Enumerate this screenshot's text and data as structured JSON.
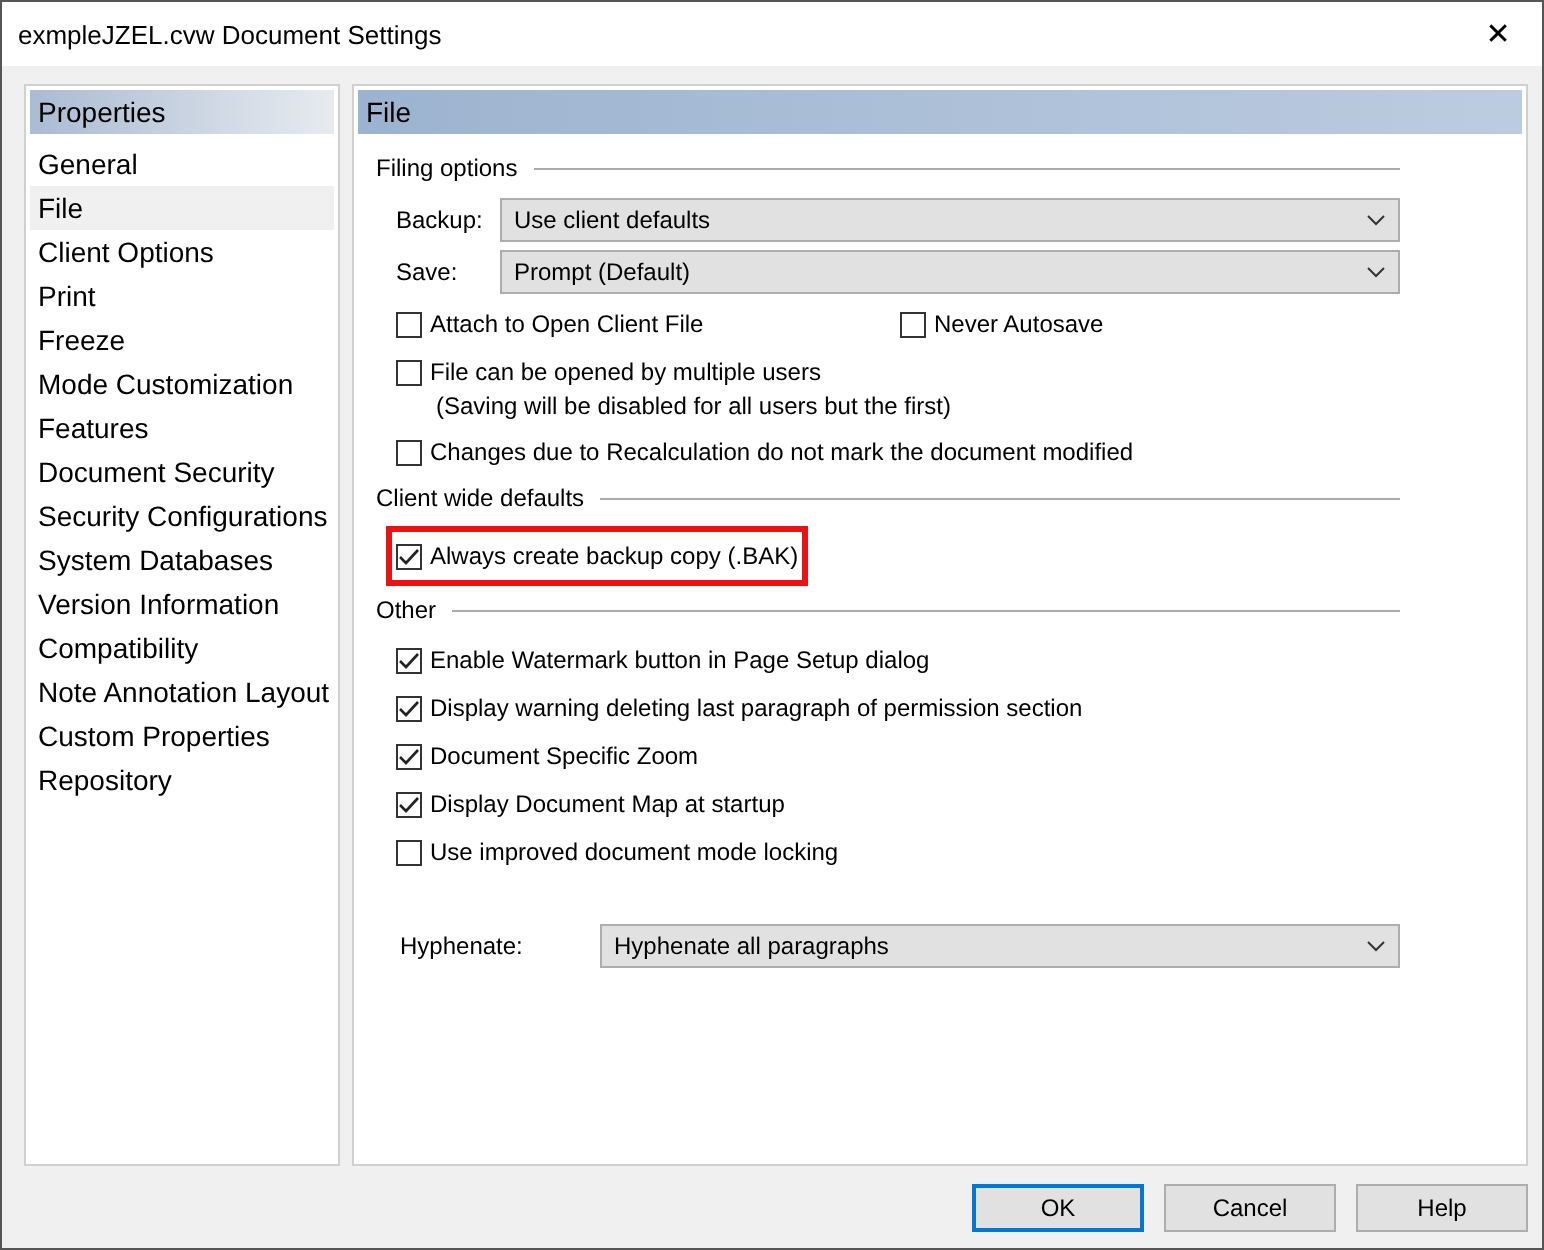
{
  "window": {
    "title": "exmpleJZEL.cvw Document Settings",
    "close": "✕"
  },
  "sidebar": {
    "title": "Properties",
    "items": [
      {
        "label": "General",
        "selected": false
      },
      {
        "label": "File",
        "selected": true
      },
      {
        "label": "Client Options",
        "selected": false
      },
      {
        "label": "Print",
        "selected": false
      },
      {
        "label": "Freeze",
        "selected": false
      },
      {
        "label": "Mode Customization",
        "selected": false
      },
      {
        "label": "Features",
        "selected": false
      },
      {
        "label": "Document Security",
        "selected": false
      },
      {
        "label": "Security Configurations",
        "selected": false
      },
      {
        "label": "System Databases",
        "selected": false
      },
      {
        "label": "Version Information",
        "selected": false
      },
      {
        "label": "Compatibility",
        "selected": false
      },
      {
        "label": "Note Annotation Layout",
        "selected": false
      },
      {
        "label": "Custom Properties",
        "selected": false
      },
      {
        "label": "Repository",
        "selected": false
      }
    ]
  },
  "panel": {
    "title": "File",
    "sections": [
      {
        "title": "Filing options",
        "items": [
          {
            "kind": "dropdown",
            "label": "Backup:",
            "value": "Use client defaults"
          },
          {
            "kind": "dropdown",
            "label": "Save:",
            "value": "Prompt (Default)"
          },
          {
            "kind": "pair",
            "options": [
              {
                "label": "Attach to Open Client File",
                "checked": false
              },
              {
                "label": "Never Autosave",
                "checked": false
              }
            ]
          },
          {
            "kind": "checkbox",
            "label": "File can be opened by multiple users",
            "note": "(Saving will be disabled for all users but the first)",
            "checked": false
          },
          {
            "kind": "checkbox",
            "label": "Changes due to Recalculation do not mark the document modified",
            "checked": false
          }
        ]
      },
      {
        "title": "Client wide defaults",
        "items": [
          {
            "kind": "checkbox",
            "label": "Always create backup copy (.BAK)",
            "checked": true,
            "highlighted": true
          }
        ]
      },
      {
        "title": "Other",
        "items": [
          {
            "kind": "checkbox",
            "label": "Enable Watermark button in Page Setup dialog",
            "checked": true
          },
          {
            "kind": "checkbox",
            "label": "Display warning deleting last paragraph of permission section",
            "checked": true
          },
          {
            "kind": "checkbox",
            "label": "Document Specific Zoom",
            "checked": true
          },
          {
            "kind": "checkbox",
            "label": "Display Document Map at startup",
            "checked": true
          },
          {
            "kind": "checkbox",
            "label": "Use improved document mode locking",
            "checked": false
          }
        ]
      }
    ],
    "hyphenate": {
      "label": "Hyphenate:",
      "value": "Hyphenate all paragraphs"
    }
  },
  "buttons": [
    {
      "label": "OK",
      "default": true
    },
    {
      "label": "Cancel",
      "default": false
    },
    {
      "label": "Help",
      "default": false
    }
  ]
}
